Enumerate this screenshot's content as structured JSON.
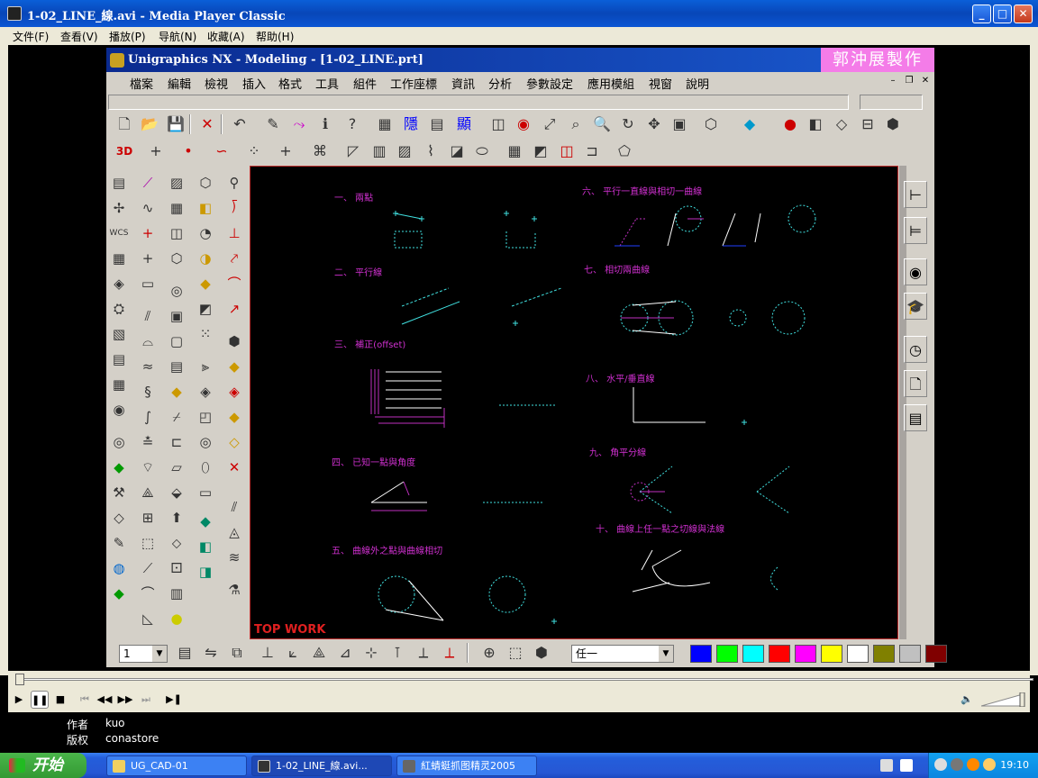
{
  "mpc": {
    "title": "1-02_LINE_線.avi - Media Player Classic",
    "menu": [
      "文件(F)",
      "查看(V)",
      "播放(P)",
      "导航(N)",
      "收藏(A)",
      "帮助(H)"
    ],
    "info": {
      "author_label": "作者",
      "author": "kuo",
      "copyright_label": "版权",
      "copyright": "conastore"
    }
  },
  "nx": {
    "title": "Unigraphics NX - Modeling - [1-02_LINE.prt]",
    "stamp": "郭沖展製作",
    "menu": [
      "檔案",
      "編輯",
      "檢視",
      "插入",
      "格式",
      "工具",
      "組件",
      "工作座標",
      "資訊",
      "分析",
      "參數設定",
      "應用模組",
      "視窗",
      "說明"
    ],
    "layer_value": "1",
    "type_filter": "任一",
    "colors": [
      "#0000ff",
      "#00ff00",
      "#00ffff",
      "#ff0000",
      "#ff00ff",
      "#ffff00",
      "#ffffff",
      "#808000",
      "#c0c0c0",
      "#800000"
    ]
  },
  "canvas": {
    "watermark": "TOP WORK",
    "labels": [
      "一、 兩點",
      "二、 平行線",
      "三、 補正(offset)",
      "四、 已知一點與角度",
      "五、 曲線外之點與曲線相切",
      "六、 平行一直線與相切一曲線",
      "七、 相切兩曲線",
      "八、 水平/垂直線",
      "九、 角平分線",
      "十、 曲線上任一點之切線與法線"
    ]
  },
  "taskbar": {
    "start": "开始",
    "tasks": [
      "UG_CAD-01",
      "1-02_LINE_線.avi...",
      "紅蜻蜓抓图精灵2005"
    ],
    "clock": "19:10"
  }
}
